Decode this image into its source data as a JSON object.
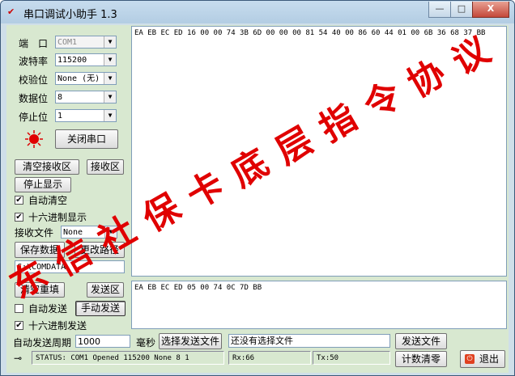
{
  "window": {
    "title": "串口调试小助手 1.3",
    "faint_menu": [
      "",
      ""
    ],
    "min_glyph": "—",
    "max_glyph": "□",
    "close_glyph": "X"
  },
  "serial": {
    "port_label": "端　口",
    "port_value": "COM1",
    "baud_label": "波特率",
    "baud_value": "115200",
    "parity_label": "校验位",
    "parity_value": "None (无)",
    "databits_label": "数据位",
    "databits_value": "8",
    "stopbits_label": "停止位",
    "stopbits_value": "1",
    "close_port_button": "关闭串口"
  },
  "receive": {
    "clear_button": "清空接收区",
    "area_button": "接收区",
    "stop_display_button": "停止显示",
    "auto_clear_label": "自动清空",
    "auto_clear_checked": true,
    "hex_display_label": "十六进制显示",
    "hex_display_checked": true,
    "file_label": "接收文件",
    "file_value": "None",
    "save_data_button": "保存数据",
    "change_path_button": "更改路径",
    "path_value": "C:\\COMDATA",
    "text": "EA EB EC ED 16 00 00 74 3B 6D 00 00 00 81 54 40 00 86 60 44 01 00 6B 36 68 37 BB"
  },
  "send": {
    "clear_button": "清空重填",
    "area_button": "发送区",
    "auto_send_label": "自动发送",
    "auto_send_checked": false,
    "manual_send_button": "手动发送",
    "hex_send_label": "十六进制发送",
    "hex_send_checked": true,
    "period_label": "自动发送周期",
    "period_value": "1000",
    "ms_label": "毫秒",
    "choose_file_button": "选择发送文件",
    "file_status": "还没有选择文件",
    "send_file_button": "发送文件",
    "text": "EA EB EC ED 05 00 74 0C 7D BB"
  },
  "status": {
    "text": "STATUS: COM1 Opened 115200 None  8 1",
    "rx": "Rx:66",
    "tx": "Tx:50",
    "reset_count_button": "计数清零",
    "exit_button": "退出"
  },
  "watermark": {
    "chars": [
      "东",
      "信",
      "社",
      "保",
      "卡",
      "底",
      "层",
      "指",
      "令",
      "协",
      "议"
    ],
    "color": "#e00000"
  }
}
